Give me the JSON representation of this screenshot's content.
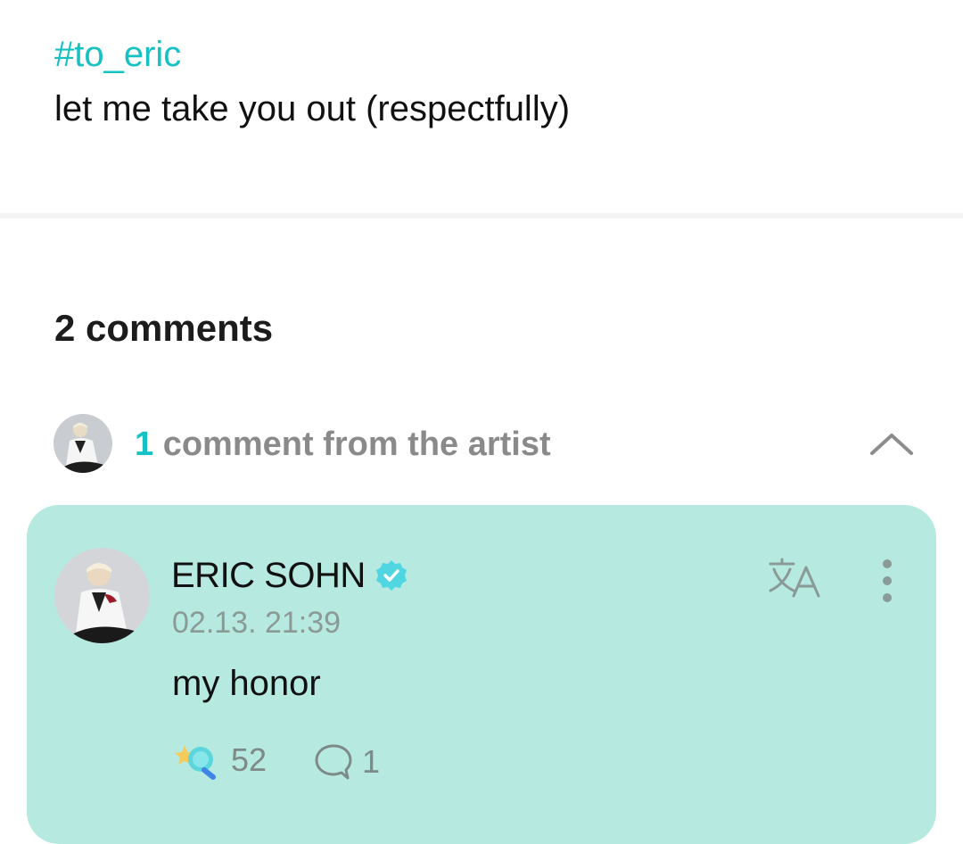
{
  "post": {
    "hashtag": "#to_eric",
    "body": "let me take you out (respectfully)"
  },
  "comments": {
    "count_label": "2 comments",
    "artist_section": {
      "count": "1",
      "label": " comment from the artist"
    }
  },
  "artist_comment": {
    "author": "ERIC SOHN",
    "timestamp": "02.13. 21:39",
    "text": "my honor",
    "reaction_count": "52",
    "reply_count": "1"
  },
  "colors": {
    "accent": "#16c1c3",
    "card_background": "#b6eae0",
    "verified_badge": "#4fd6e0"
  },
  "icons": [
    "chevron-up-icon",
    "verified-badge-icon",
    "translate-icon",
    "more-vertical-icon",
    "reaction-icon",
    "comment-bubble-icon"
  ]
}
